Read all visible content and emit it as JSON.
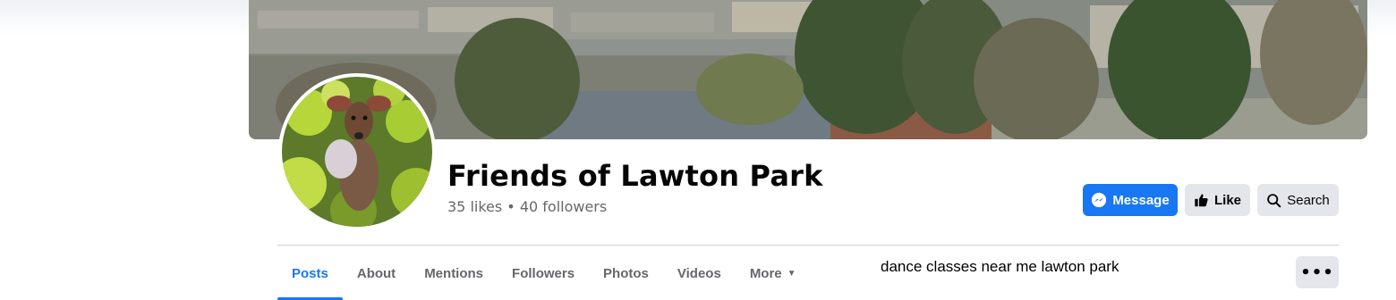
{
  "page": {
    "title": "Friends of Lawton Park",
    "stats": "35 likes • 40 followers"
  },
  "actions": {
    "message_label": "Message",
    "like_label": "Like",
    "search_label": "Search"
  },
  "tabs": [
    {
      "label": "Posts",
      "active": true
    },
    {
      "label": "About"
    },
    {
      "label": "Mentions"
    },
    {
      "label": "Followers"
    },
    {
      "label": "Photos"
    },
    {
      "label": "Videos"
    },
    {
      "label": "More"
    }
  ],
  "overlay_text": "dance classes near me lawton park",
  "icons": {
    "message": "messenger-icon",
    "like": "thumbs-up-icon",
    "search": "search-icon",
    "more_tab": "caret-down-icon",
    "more_button": "ellipsis-icon"
  },
  "colors": {
    "accent": "#1877f2",
    "secondary_button": "#e4e6eb",
    "muted_text": "#65676b",
    "title_text": "#050505"
  }
}
